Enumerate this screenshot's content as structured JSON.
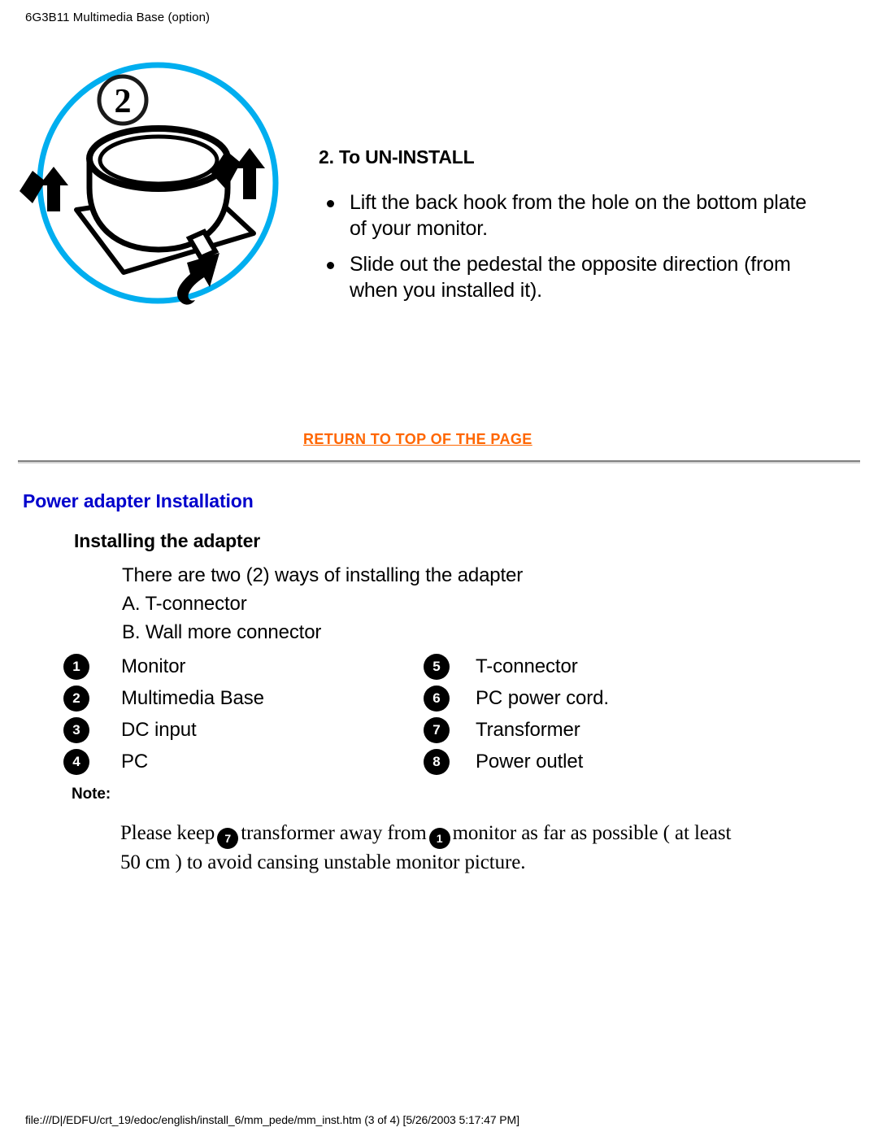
{
  "header": {
    "title": "6G3B11 Multimedia Base (option)"
  },
  "illustration": {
    "step_badge": "2",
    "circle_color": "#00AEEF",
    "alt": "Pedestal un-install diagram with directional arrows"
  },
  "step": {
    "title": "2. To UN-INSTALL",
    "bullets": [
      "Lift the back hook from the hole on the bottom plate of your monitor.",
      "Slide out the pedestal the opposite direction (from when you installed it)."
    ]
  },
  "return_link": {
    "label": "RETURN TO TOP OF THE PAGE",
    "color": "#FF6600"
  },
  "section": {
    "title": "Power adapter Installation",
    "title_color": "#0000CC",
    "subtitle": "Installing the adapter",
    "intro_lines": [
      "There are two (2) ways of installing the adapter",
      "A. T-connector",
      "B. Wall more connector"
    ]
  },
  "legend": {
    "left": [
      {
        "num": "1",
        "label": "Monitor"
      },
      {
        "num": "2",
        "label": "Multimedia Base"
      },
      {
        "num": "3",
        "label": "DC input"
      },
      {
        "num": "4",
        "label": "PC"
      }
    ],
    "right": [
      {
        "num": "5",
        "label": "T-connector"
      },
      {
        "num": "6",
        "label": "PC power cord."
      },
      {
        "num": "7",
        "label": "Transformer"
      },
      {
        "num": "8",
        "label": "Power outlet"
      }
    ]
  },
  "note": {
    "label": "Note:",
    "part1": "Please keep",
    "badge1": "7",
    "part2": "transformer away from",
    "badge2": "1",
    "part3": "monitor as far as possible ( at least 50 cm ) to avoid cansing unstable monitor picture."
  },
  "footer": {
    "path": "file:///D|/EDFU/crt_19/edoc/english/install_6/mm_pede/mm_inst.htm (3 of 4) [5/26/2003 5:17:47 PM]"
  }
}
